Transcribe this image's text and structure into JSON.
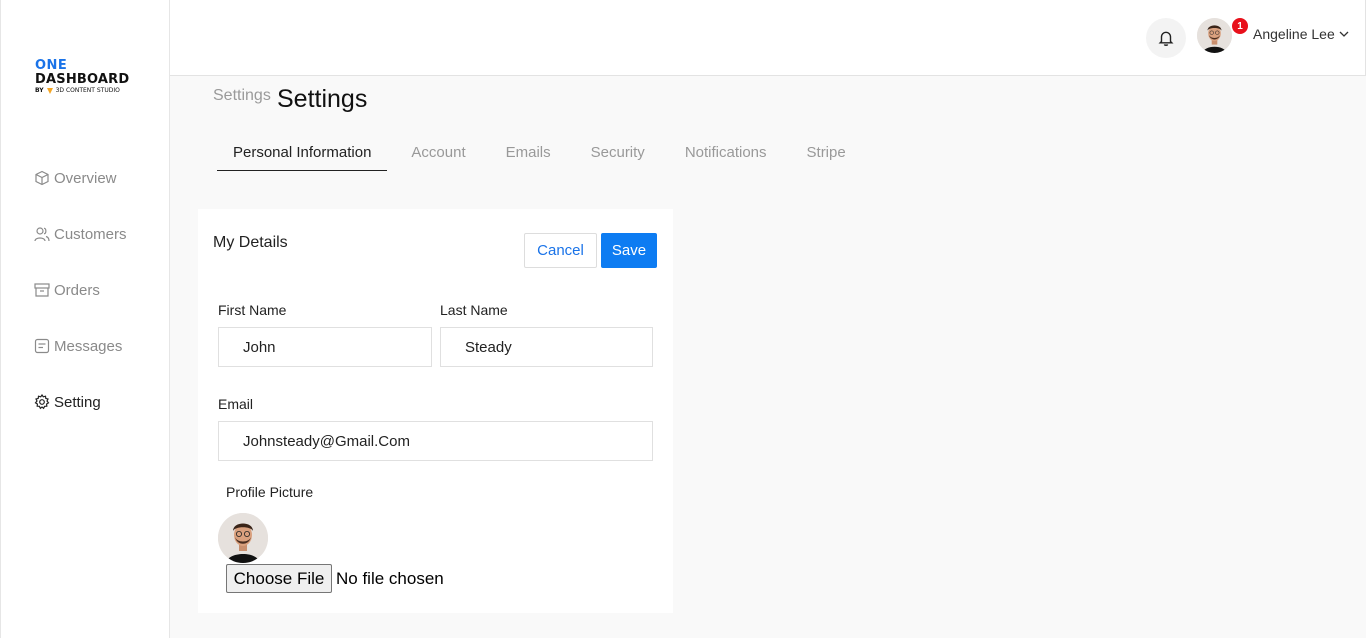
{
  "brand": {
    "line1": "ONE",
    "line2": "DASHBOARD",
    "line3_by": "BY",
    "line3_studio": "3D CONTENT STUDIO"
  },
  "sidebar": {
    "items": [
      {
        "label": "Overview",
        "icon": "cube-icon",
        "active": false
      },
      {
        "label": "Customers",
        "icon": "users-icon",
        "active": false
      },
      {
        "label": "Orders",
        "icon": "archive-icon",
        "active": false
      },
      {
        "label": "Messages",
        "icon": "message-icon",
        "active": false
      },
      {
        "label": "Setting",
        "icon": "gear-icon",
        "active": true
      }
    ]
  },
  "topbar": {
    "user_name": "Angeline Lee",
    "notification_count": "1"
  },
  "header": {
    "breadcrumb": "Settings",
    "title": "Settings"
  },
  "tabs": [
    {
      "label": "Personal Information",
      "active": true
    },
    {
      "label": "Account",
      "active": false
    },
    {
      "label": "Emails",
      "active": false
    },
    {
      "label": "Security",
      "active": false
    },
    {
      "label": "Notifications",
      "active": false
    },
    {
      "label": "Stripe",
      "active": false
    }
  ],
  "details": {
    "title": "My Details",
    "cancel_label": "Cancel",
    "save_label": "Save",
    "first_name_label": "First Name",
    "first_name_value": "John",
    "last_name_label": "Last Name",
    "last_name_value": "Steady",
    "email_label": "Email",
    "email_value": "Johnsteady@Gmail.Com",
    "profile_picture_label": "Profile Picture",
    "choose_file_label": "Choose File",
    "file_status": "No file chosen"
  },
  "colors": {
    "accent": "#0d7cf2",
    "badge": "#e8101b",
    "brand_blue": "#1a73e8"
  }
}
